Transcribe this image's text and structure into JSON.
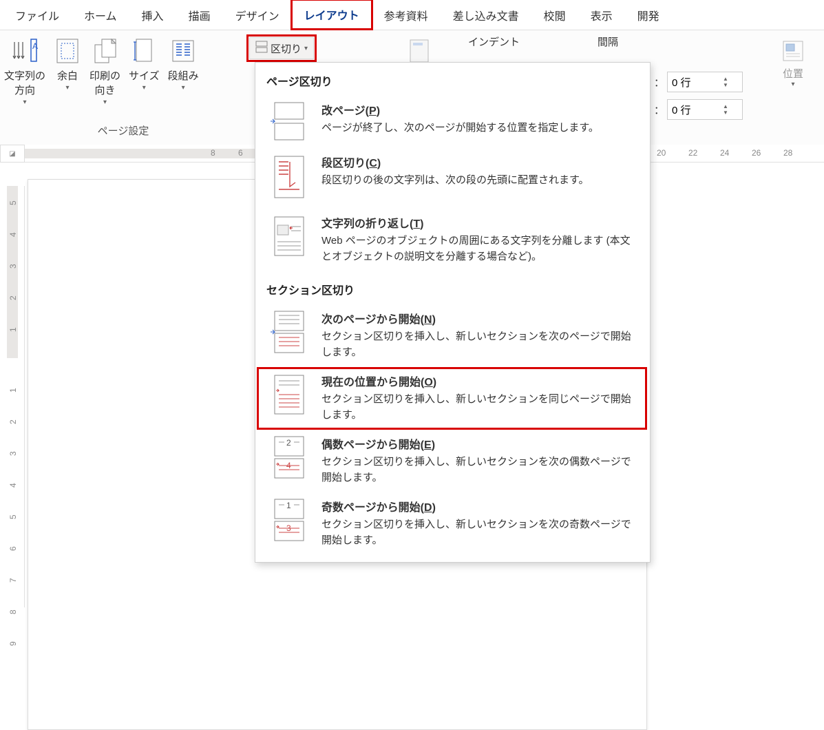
{
  "tabs": {
    "file": "ファイル",
    "home": "ホーム",
    "insert": "挿入",
    "draw": "描画",
    "design": "デザイン",
    "layout": "レイアウト",
    "references": "参考資料",
    "mailings": "差し込み文書",
    "review": "校閲",
    "view": "表示",
    "developer": "開発"
  },
  "ribbon": {
    "text_direction": "文字列の\n方向",
    "margins": "余白",
    "orientation": "印刷の\n向き",
    "size": "サイズ",
    "columns": "段組み",
    "breaks_label": "区切り",
    "page_setup_group": "ページ設定",
    "indent_label": "インデント",
    "spacing_label": "間隔",
    "before_suffix": "：",
    "before_value": "0 行",
    "after_suffix": "：",
    "after_value": "0 行",
    "position": "位置"
  },
  "ruler": {
    "h_marks": [
      "8",
      "6"
    ],
    "h_marks_right": [
      "20",
      "22",
      "24",
      "26",
      "28"
    ],
    "v_marks": [
      "5",
      "4",
      "3",
      "2",
      "1",
      "1",
      "2",
      "3",
      "4",
      "5",
      "6",
      "7",
      "8",
      "9"
    ]
  },
  "breaks_menu": {
    "cat1": "ページ区切り",
    "cat2": "セクション区切り",
    "items": [
      {
        "title_pre": "改ページ(",
        "hotkey": "P",
        "title_post": ")",
        "desc": "ページが終了し、次のページが開始する位置を指定します。"
      },
      {
        "title_pre": "段区切り(",
        "hotkey": "C",
        "title_post": ")",
        "desc": "段区切りの後の文字列は、次の段の先頭に配置されます。"
      },
      {
        "title_pre": "文字列の折り返し(",
        "hotkey": "T",
        "title_post": ")",
        "desc": "Web ページのオブジェクトの周囲にある文字列を分離します (本文とオブジェクトの説明文を分離する場合など)。"
      },
      {
        "title_pre": "次のページから開始(",
        "hotkey": "N",
        "title_post": ")",
        "desc": "セクション区切りを挿入し、新しいセクションを次のページで開始します。"
      },
      {
        "title_pre": "現在の位置から開始(",
        "hotkey": "O",
        "title_post": ")",
        "desc": "セクション区切りを挿入し、新しいセクションを同じページで開始します。"
      },
      {
        "title_pre": "偶数ページから開始(",
        "hotkey": "E",
        "title_post": ")",
        "desc": "セクション区切りを挿入し、新しいセクションを次の偶数ページで開始します。"
      },
      {
        "title_pre": "奇数ページから開始(",
        "hotkey": "D",
        "title_post": ")",
        "desc": "セクション区切りを挿入し、新しいセクションを次の奇数ページで開始します。"
      }
    ]
  }
}
